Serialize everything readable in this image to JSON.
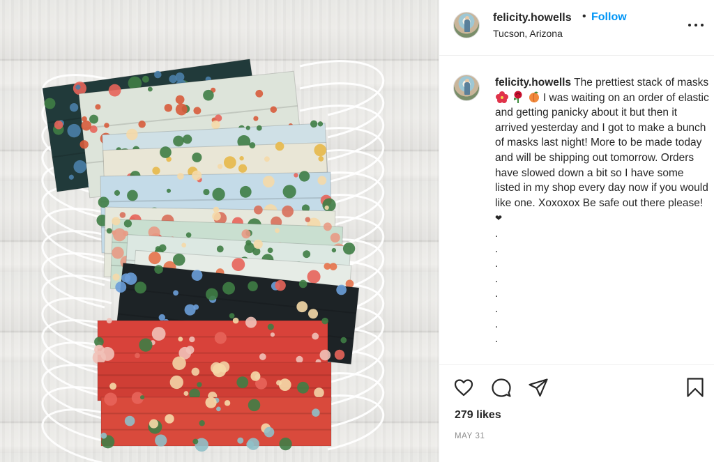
{
  "post": {
    "username": "felicity.howells",
    "follow_label": "Follow",
    "separator": "•",
    "location": "Tucson, Arizona",
    "more_icon": "more-options-icon"
  },
  "caption": {
    "username": "felicity.howells",
    "text_before_emoji": "The prettiest stack of masks",
    "emojis": [
      "hibiscus",
      "rose",
      "peach"
    ],
    "text_after_emoji": "I was waiting on an order of elastic and getting panicky about it but then it arrived yesterday and I got to make a bunch of masks last night! More to be made today and will be shipping out tomorrow. Orders have slowed down a bit so I have some listed in my shop every day now if you would like one. Xoxoxox Be safe out there please!",
    "heart": "❤",
    "dots": [
      ".",
      ".",
      ".",
      ".",
      ".",
      ".",
      ".",
      "."
    ]
  },
  "actions": {
    "like_icon": "heart-icon",
    "comment_icon": "comment-icon",
    "share_icon": "share-icon",
    "save_icon": "bookmark-icon"
  },
  "likes": "279 likes",
  "date": "MAY 31",
  "photo": {
    "description_icon": "photo",
    "mask_patterns": [
      {
        "base": "#213a3a",
        "accent": "#4a7fa8"
      },
      {
        "base": "#dde4da",
        "accent": "#d75b3b"
      },
      {
        "base": "#cfe0e6",
        "accent": "#3f7d45"
      },
      {
        "base": "#e9e6d6",
        "accent": "#e7b84a"
      },
      {
        "base": "#c4dbe8",
        "accent": "#3f7d45"
      },
      {
        "base": "#e6e8dc",
        "accent": "#d86f5a"
      },
      {
        "base": "#c9dfd0",
        "accent": "#e89a84"
      },
      {
        "base": "#dce8e2",
        "accent": "#3f7d45"
      },
      {
        "base": "#e6ece6",
        "accent": "#e5724a"
      },
      {
        "base": "#1d2326",
        "accent": "#6b9fd9"
      },
      {
        "base": "#d8423a",
        "accent": "#f1c1b8"
      },
      {
        "base": "#cf3e35",
        "accent": "#f2d3a6"
      },
      {
        "base": "#d94a3c",
        "accent": "#8fc0c8"
      }
    ]
  }
}
